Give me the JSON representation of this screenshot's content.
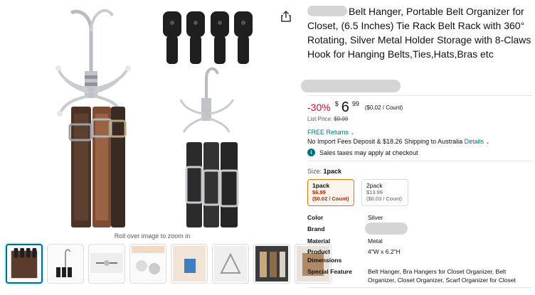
{
  "product": {
    "title": "Belt Hanger, Portable Belt Organizer for Closet, (6.5 Inches) Tie Rack Belt Rack with 360° Rotating, Silver Metal Holder Storage with 8-Claws Hook for Hanging Belts,Ties,Hats,Bras etc",
    "discount": "-30%",
    "price_symbol": "$",
    "price_whole": "6",
    "price_fraction": "99",
    "unit_price": "($0.02 / Count)",
    "list_price_label": "List Price:",
    "list_price": "$9.99",
    "free_returns": "FREE Returns",
    "import_text": "No Import Fees Deposit & $18.26 Shipping to Australia",
    "details_link": "Details",
    "tax_notice": "Sales taxes may apply at checkout"
  },
  "gallery": {
    "hint": "Roll over image to zoom in",
    "thumbnail_count": 8
  },
  "size": {
    "label": "Size:",
    "selected": "1pack",
    "options": [
      {
        "name": "1pack",
        "price": "$6.99",
        "unit": "($0.02 / Count)"
      },
      {
        "name": "2pack",
        "price": "$13.99",
        "unit": "($0.03 / Count)"
      }
    ]
  },
  "specs": [
    {
      "key": "Color",
      "value": "Silver"
    },
    {
      "key": "Brand",
      "value": ""
    },
    {
      "key": "Material",
      "value": "Metal"
    },
    {
      "key": "Product Dimensions",
      "value": "4\"W x 6.2\"H"
    },
    {
      "key": "Special Feature",
      "value": "Belt Hanger, Bra Hangers for Closet Organizer, Belt Organizer, Closet Organizer, Scarf Organizer for Closet"
    }
  ],
  "colors": {
    "link": "#007185",
    "discount": "#cc0c39",
    "selected_border": "#e77600",
    "sale_price": "#b12704"
  }
}
